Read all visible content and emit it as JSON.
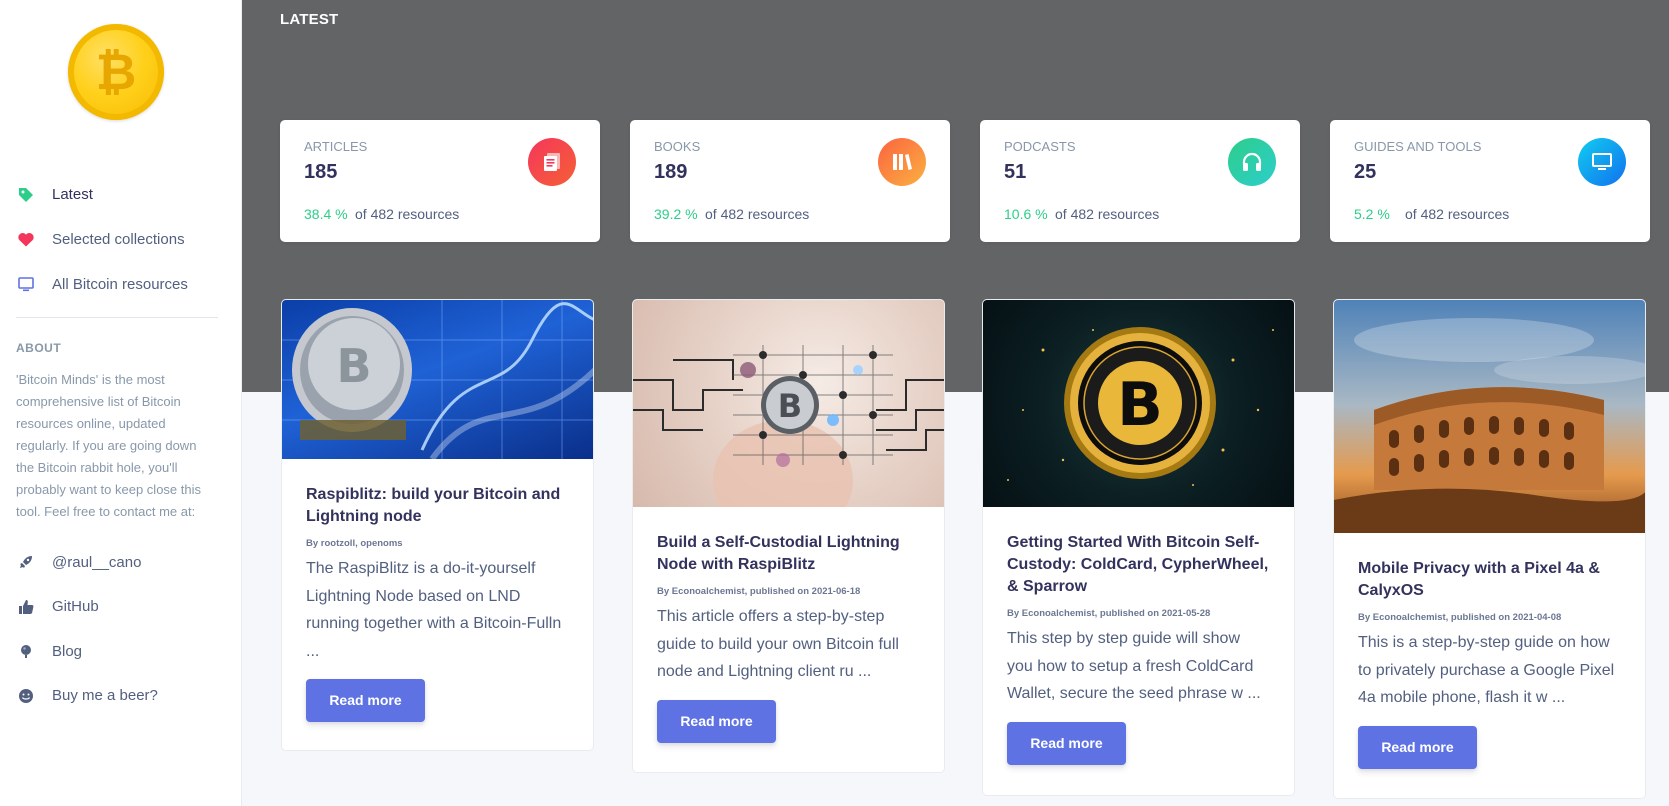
{
  "sidebar": {
    "nav": [
      {
        "label": "Latest",
        "icon": "tag-icon",
        "color": "#2dce89"
      },
      {
        "label": "Selected collections",
        "icon": "heart-icon",
        "color": "#f5365c"
      },
      {
        "label": "All Bitcoin resources",
        "icon": "monitor-icon",
        "color": "#5e72e4"
      }
    ],
    "about_heading": "ABOUT",
    "about_text": "'Bitcoin Minds' is the most comprehensive list of Bitcoin resources online, updated regularly. If you are going down the Bitcoin rabbit hole, you'll probably want to keep close this tool. Feel free to contact me at:",
    "social": [
      {
        "label": "@raul__cano",
        "icon": "rocket-icon"
      },
      {
        "label": "GitHub",
        "icon": "thumbs-up-icon"
      },
      {
        "label": "Blog",
        "icon": "planet-icon"
      },
      {
        "label": "Buy me a beer?",
        "icon": "smiley-icon"
      }
    ]
  },
  "header": {
    "title": "LATEST"
  },
  "stats": [
    {
      "name": "ARTICLES",
      "count": "185",
      "percent": "38.4 %",
      "of": "of 482 resources",
      "icon": "article-icon",
      "color": "#f5365c"
    },
    {
      "name": "BOOKS",
      "count": "189",
      "percent": "39.2 %",
      "of": "of 482 resources",
      "icon": "books-icon",
      "color": "#fb6340"
    },
    {
      "name": "PODCASTS",
      "count": "51",
      "percent": "10.6 %",
      "of": "of 482 resources",
      "icon": "headphones-icon",
      "color": "#2dce89"
    },
    {
      "name": "GUIDES AND TOOLS",
      "count": "25",
      "percent": "5.2 %",
      "of": "of 482 resources",
      "icon": "monitor-icon",
      "color": "#11cdef"
    }
  ],
  "cards": [
    {
      "title": "Raspiblitz: build your Bitcoin and Lightning node",
      "byline": "By rootzoll, openoms",
      "description": "The RaspiBlitz is a do-it-yourself Lightning Node based on LND running together with a Bitcoin-Fulln ...",
      "button": "Read more"
    },
    {
      "title": "Build a Self-Custodial Lightning Node with RaspiBlitz",
      "byline": "By Econoalchemist, published on 2021-06-18",
      "description": "This article offers a step-by-step guide to build your own Bitcoin full node and Lightning client ru ...",
      "button": "Read more"
    },
    {
      "title": "Getting Started With Bitcoin Self-Custody: ColdCard, CypherWheel, & Sparrow",
      "byline": "By Econoalchemist, published on 2021-05-28",
      "description": "This step by step guide will show you how to setup a fresh ColdCard Wallet, secure the seed phrase w ...",
      "button": "Read more"
    },
    {
      "title": "Mobile Privacy with a Pixel 4a & CalyxOS",
      "byline": "By Econoalchemist, published on 2021-04-08",
      "description": "This is a step-by-step guide on how to privately purchase a Google Pixel 4a mobile phone, flash it w ...",
      "button": "Read more"
    }
  ],
  "logo_symbol": "₿"
}
